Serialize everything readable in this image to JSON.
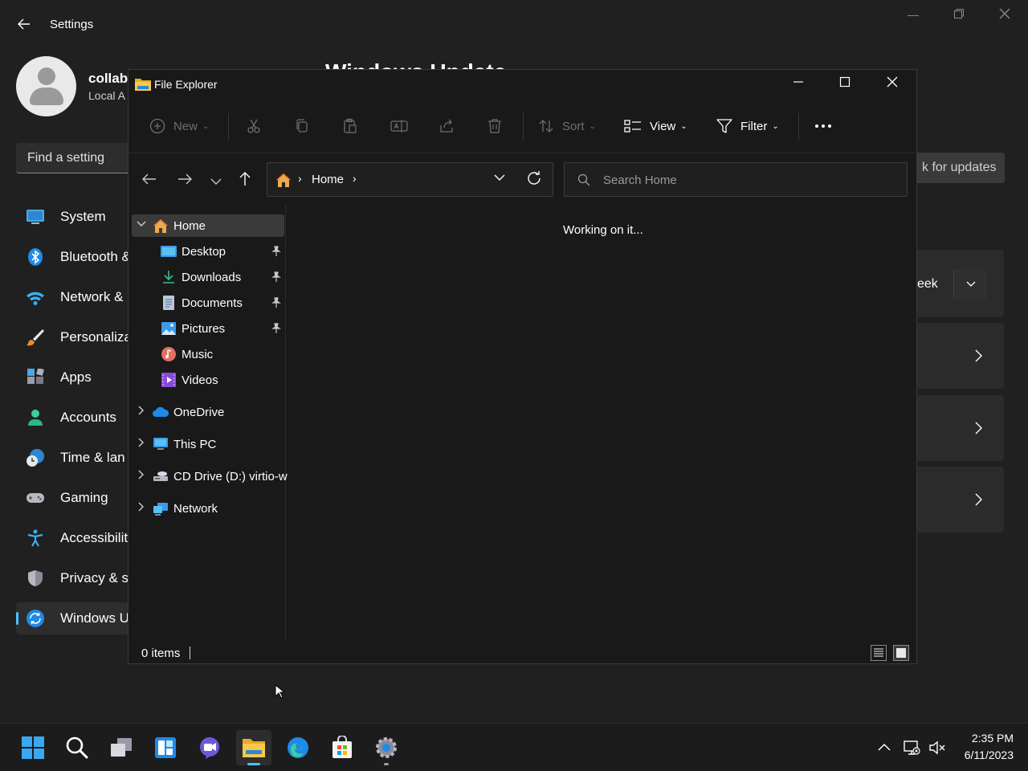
{
  "settings": {
    "title": "Settings",
    "user": {
      "name": "collab",
      "account": "Local A"
    },
    "search_placeholder": "Find a setting",
    "nav": [
      {
        "label": "System",
        "icon": "system-icon"
      },
      {
        "label": "Bluetooth &",
        "icon": "bluetooth-icon"
      },
      {
        "label": "Network &",
        "icon": "wifi-icon"
      },
      {
        "label": "Personaliza",
        "icon": "brush-icon"
      },
      {
        "label": "Apps",
        "icon": "apps-icon"
      },
      {
        "label": "Accounts",
        "icon": "accounts-icon"
      },
      {
        "label": "Time & lan",
        "icon": "clock-icon"
      },
      {
        "label": "Gaming",
        "icon": "gamepad-icon"
      },
      {
        "label": "Accessibilit",
        "icon": "accessibility-icon"
      },
      {
        "label": "Privacy & s",
        "icon": "shield-icon"
      },
      {
        "label": "Windows U",
        "icon": "windows-update-icon"
      }
    ],
    "page_heading": "Windows Update",
    "check_button": "k for updates",
    "pause_label": "eek",
    "accent": "#4cc2ff"
  },
  "explorer": {
    "title": "File Explorer",
    "commands": {
      "new": "New",
      "sort": "Sort",
      "view": "View",
      "filter": "Filter"
    },
    "address": {
      "crumb": "Home"
    },
    "search_placeholder": "Search Home",
    "tree": [
      {
        "label": "Home",
        "icon": "home-icon",
        "level": 0,
        "expanded": true,
        "selected": true
      },
      {
        "label": "Desktop",
        "icon": "desktop-folder-icon",
        "level": 1,
        "pinned": true
      },
      {
        "label": "Downloads",
        "icon": "downloads-icon",
        "level": 1,
        "pinned": true
      },
      {
        "label": "Documents",
        "icon": "documents-icon",
        "level": 1,
        "pinned": true
      },
      {
        "label": "Pictures",
        "icon": "pictures-icon",
        "level": 1,
        "pinned": true
      },
      {
        "label": "Music",
        "icon": "music-icon",
        "level": 1
      },
      {
        "label": "Videos",
        "icon": "videos-icon",
        "level": 1
      },
      {
        "label": "OneDrive",
        "icon": "onedrive-icon",
        "level": 0
      },
      {
        "label": "This PC",
        "icon": "this-pc-icon",
        "level": 0
      },
      {
        "label": "CD Drive (D:) virtio-w",
        "icon": "cd-drive-icon",
        "level": 0
      },
      {
        "label": "Network",
        "icon": "network-icon",
        "level": 0
      }
    ],
    "content_status": "Working on it...",
    "item_count": "0 items"
  },
  "taskbar": {
    "time": "2:35 PM",
    "date": "6/11/2023"
  }
}
